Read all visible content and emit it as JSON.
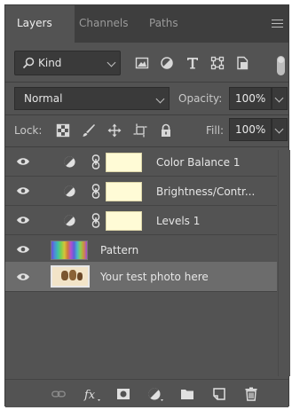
{
  "tabs": [
    {
      "label": "Layers",
      "active": true
    },
    {
      "label": "Channels",
      "active": false
    },
    {
      "label": "Paths",
      "active": false
    }
  ],
  "filter": {
    "kind_label": "Kind",
    "icons": [
      "pixel-filter-icon",
      "adjustment-filter-icon",
      "type-filter-icon",
      "shape-filter-icon",
      "smart-object-filter-icon"
    ]
  },
  "blend": {
    "mode": "Normal",
    "opacity_label": "Opacity:",
    "opacity_value": "100%"
  },
  "lock": {
    "label": "Lock:",
    "icons": [
      "lock-transparent-pixels-icon",
      "lock-image-pixels-icon",
      "lock-position-icon",
      "lock-artboard-icon",
      "lock-all-icon"
    ],
    "fill_label": "Fill:",
    "fill_value": "100%"
  },
  "layers": [
    {
      "name": "Color Balance 1",
      "type": "adjustment",
      "visible": true,
      "selected": false
    },
    {
      "name": "Brightness/Contr...",
      "type": "adjustment",
      "visible": true,
      "selected": false
    },
    {
      "name": "Levels 1",
      "type": "adjustment",
      "visible": true,
      "selected": false
    },
    {
      "name": "Pattern",
      "type": "pattern",
      "visible": true,
      "selected": false
    },
    {
      "name": "Your test photo here",
      "type": "photo",
      "visible": true,
      "selected": true
    }
  ],
  "footer_icons": [
    "link-layers-icon",
    "fx-icon",
    "add-mask-icon",
    "new-adjustment-layer-icon",
    "new-group-icon",
    "new-layer-icon",
    "delete-layer-icon"
  ],
  "colors": {
    "panel_bg": "#535353",
    "tabbar_bg": "#3e3e3e",
    "field_bg": "#3a3a3a",
    "selected_row": "#6c6c6c",
    "mask_fill": "#fffbd6"
  }
}
